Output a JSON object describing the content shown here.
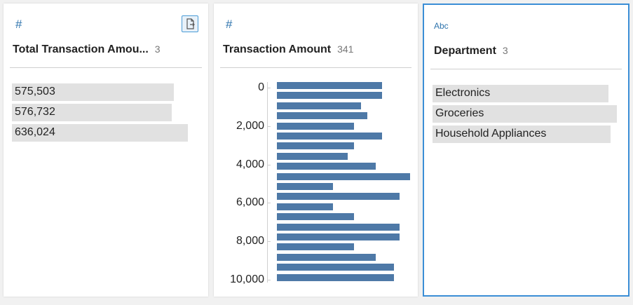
{
  "fields": [
    {
      "type_icon": "#",
      "type_icon_name": "hash-icon",
      "title": "Total Transaction Amou...",
      "count": "3",
      "values": [
        {
          "label": "575,503",
          "fraction": 0.79
        },
        {
          "label": "576,732",
          "fraction": 0.78
        },
        {
          "label": "636,024",
          "fraction": 0.86
        }
      ]
    },
    {
      "type_icon": "#",
      "type_icon_name": "hash-icon",
      "title": "Transaction Amount",
      "count": "341"
    },
    {
      "type_icon": "Abc",
      "type_icon_name": "abc-icon",
      "title": "Department",
      "count": "3",
      "values": [
        {
          "label": "Electronics",
          "fraction": 0.85
        },
        {
          "label": "Groceries",
          "fraction": 0.89
        },
        {
          "label": "Household Appliances",
          "fraction": 0.86
        }
      ]
    }
  ],
  "chart_data": {
    "type": "bar",
    "orientation": "horizontal",
    "axis_ticks": [
      "0",
      "2,000",
      "4,000",
      "6,000",
      "8,000",
      "10,000"
    ],
    "ylim": [
      0,
      10000
    ],
    "bin_counts_relative": [
      0.79,
      0.79,
      0.63,
      0.68,
      0.58,
      0.79,
      0.58,
      0.53,
      0.74,
      1.0,
      0.42,
      0.92,
      0.42,
      0.58,
      0.92,
      0.92,
      0.58,
      0.74,
      0.88,
      0.88
    ]
  },
  "colors": {
    "bar": "#4e79a7",
    "value_bg": "#e1e1e1",
    "selected_border": "#3b8ed6",
    "type_icon": "#2f74ad"
  }
}
